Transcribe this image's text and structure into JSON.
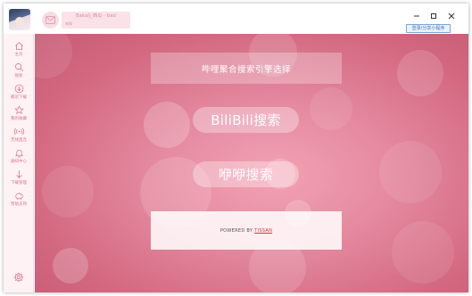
{
  "titlebar": {
    "title": "Bakalj_西瓜 · bad",
    "subtitle": "未知",
    "share_label": "登录/分享小程序"
  },
  "sidebar": {
    "items": [
      {
        "label": "主页",
        "icon": "home-icon"
      },
      {
        "label": "搜索",
        "icon": "search-icon"
      },
      {
        "label": "最近下载",
        "icon": "download-icon"
      },
      {
        "label": "我的收藏",
        "icon": "star-icon"
      },
      {
        "label": "无线直连",
        "icon": "wireless-icon"
      },
      {
        "label": "通知中心",
        "icon": "bell-icon"
      },
      {
        "label": "下载管理",
        "icon": "arrow-down-icon"
      },
      {
        "label": "赞助支持",
        "icon": "piggy-bank-icon"
      }
    ],
    "settings_icon": "gear-icon"
  },
  "main": {
    "heading": "哔哩聚合搜索引擎选择",
    "bili_button": "BiliBili搜索",
    "mimi_button": "咿咿搜索",
    "powered_prefix": "POWERED BY",
    "powered_brand": "TISSAN"
  },
  "colors": {
    "accent": "#e07b93",
    "background_pink": "#e58aa0",
    "sidebar_bg": "#fff2f5",
    "brand_red": "#e0303c"
  }
}
